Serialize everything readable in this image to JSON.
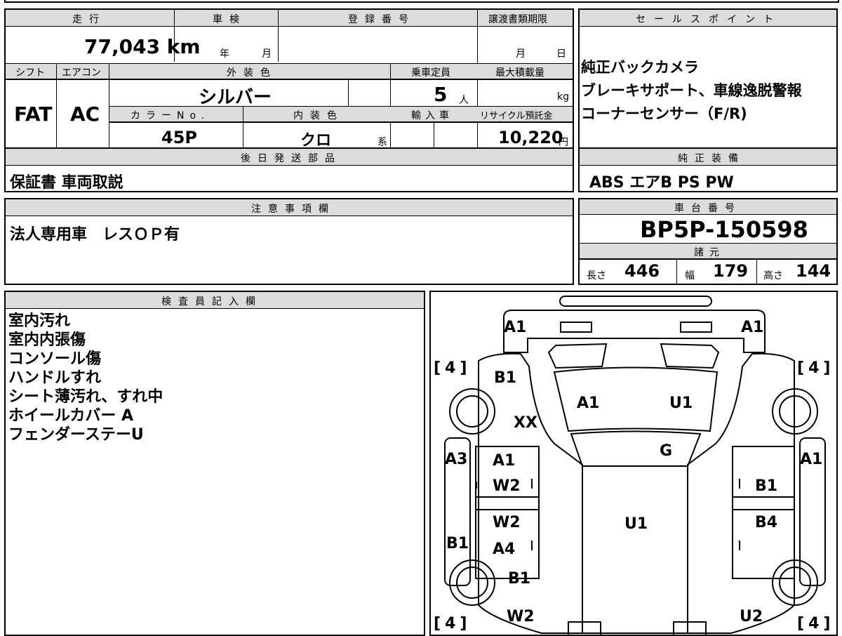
{
  "headers": {
    "mileage": "走行",
    "inspection": "車検",
    "registration": "登録番号",
    "transfer_deadline": "譲渡書類期限",
    "sales_points": "セールスポイント",
    "shift": "シフト",
    "aircon": "エアコン",
    "exterior_color": "外装色",
    "capacity": "乗車定員",
    "max_load": "最大積載量",
    "color_no": "カラーNo.",
    "interior_color": "内装色",
    "import": "輸入車",
    "recycle": "リサイクル預託金",
    "deferred_parts": "後日発送部品",
    "factory_equipment": "純正装備",
    "notes": "注意事項欄",
    "chassis_no": "車台番号",
    "specs": "諸元",
    "inspector": "検査員記入欄"
  },
  "vehicle": {
    "mileage": "77,043 km",
    "inspection_year_unit": "年",
    "inspection_month_unit": "月",
    "transfer_month_unit": "月",
    "transfer_day_unit": "日",
    "shift": "FAT",
    "aircon": "AC",
    "exterior_color": "シルバー",
    "capacity": "5",
    "capacity_unit": "人",
    "max_load_unit": "kg",
    "color_no": "45P",
    "interior_color": "クロ",
    "interior_suffix": "系",
    "recycle_fee": "10,220",
    "recycle_unit": "円"
  },
  "sales_points": "純正バックカメラ\nブレーキサポート、車線逸脱警報\nコーナーセンサー（F/R)",
  "deferred_parts": "保証書 車両取説",
  "factory_equipment": "ABS エアB PS PW",
  "notes": "法人専用車　レスＯＰ有",
  "chassis_no": "BP5P-150598",
  "dimensions": {
    "length_label": "長さ",
    "length": "446",
    "width_label": "幅",
    "width": "179",
    "height_label": "高さ",
    "height": "144"
  },
  "inspector_notes": "室内汚れ\n室内内張傷\nコンソール傷\nハンドルすれ\nシート薄汚れ、すれ中\nホイールカバー A\nフェンダーステーU",
  "diagram": {
    "tires": [
      "4",
      "4",
      "4",
      "4"
    ],
    "marks": [
      "A1",
      "A1",
      "B1",
      "XX",
      "A1",
      "U1",
      "G",
      "A3",
      "A1",
      "A1",
      "W2",
      "B1",
      "W2",
      "U1",
      "B4",
      "B1",
      "A4",
      "B1",
      "W2",
      "U2"
    ]
  }
}
